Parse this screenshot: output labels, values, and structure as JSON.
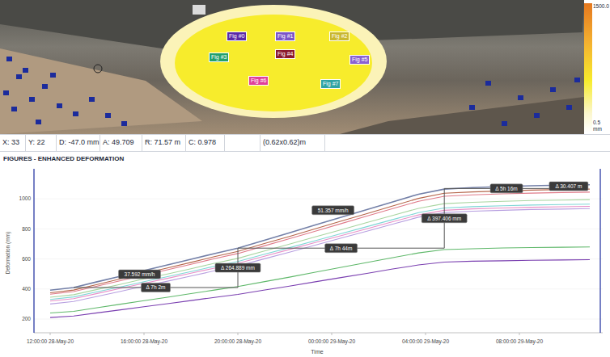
{
  "map": {
    "figures": [
      {
        "label": "Fig #0",
        "color": "#5b2aa6"
      },
      {
        "label": "Fig #1",
        "color": "#7b55c8"
      },
      {
        "label": "Fig #2",
        "color": "#c9b82e"
      },
      {
        "label": "Fig #3",
        "color": "#23a06c"
      },
      {
        "label": "Fig #4",
        "color": "#8b1a2e"
      },
      {
        "label": "Fig #5",
        "color": "#8a62d2"
      },
      {
        "label": "Fig #6",
        "color": "#e0409a"
      },
      {
        "label": "Fig #7",
        "color": "#2fa3a3"
      }
    ],
    "scale": {
      "max": "1500.0",
      "min": "0.5",
      "unit": "mm"
    }
  },
  "status_bar": [
    "X: 33",
    "Y: 22",
    "D: -47.0 mm",
    "A: 49.709",
    "R: 71.57 m",
    "C: 0.978",
    "(0.62x0.62)m"
  ],
  "chart": {
    "title": "FIGURES - ENHANCED DEFORMATION",
    "y_axis": {
      "label": "Deformation (mm)",
      "ticks": [
        "200",
        "400",
        "600",
        "800",
        "1000"
      ]
    },
    "x_axis": {
      "label": "Time",
      "ticks": [
        "12:00:00 28-May-20",
        "16:00:00 28-May-20",
        "20:00:00 28-May-20",
        "00:00:00 29-May-20",
        "04:00:00 29-May-20",
        "08:00:00 29-May-20"
      ]
    },
    "hours": [
      0,
      1,
      2,
      3,
      4,
      5,
      6,
      7,
      8,
      9.1,
      10.2,
      11.3,
      12.4,
      13.5,
      14.6,
      15.7,
      16.8,
      18,
      19.3,
      20.5,
      21.8,
      23
    ],
    "series": [
      {
        "color": "#7a3fb0",
        "values": [
          210,
          220,
          241,
          261,
          282,
          302,
          323,
          344,
          364,
          392,
          419,
          448,
          476,
          504,
          533,
          560,
          579,
          585,
          588,
          591,
          593,
          595
        ]
      },
      {
        "color": "#5fb86a",
        "values": [
          240,
          251,
          275,
          299,
          322,
          345,
          369,
          393,
          416,
          448,
          479,
          512,
          544,
          576,
          609,
          640,
          662,
          668,
          673,
          676,
          678,
          680
        ]
      },
      {
        "color": "#b8a0e0",
        "values": [
          300,
          317,
          351,
          384,
          419,
          452,
          486,
          521,
          553,
          600,
          645,
          692,
          739,
          785,
          832,
          878,
          909,
          918,
          924,
          929,
          932,
          935
        ]
      },
      {
        "color": "#e890c8",
        "values": [
          320,
          336,
          370,
          404,
          438,
          471,
          505,
          539,
          571,
          617,
          663,
          709,
          755,
          801,
          848,
          893,
          924,
          933,
          939,
          944,
          947,
          950
        ]
      },
      {
        "color": "#7fd6d6",
        "values": [
          330,
          347,
          381,
          414,
          449,
          482,
          516,
          551,
          583,
          630,
          675,
          722,
          769,
          815,
          862,
          908,
          939,
          948,
          954,
          959,
          962,
          965
        ]
      },
      {
        "color": "#a8d5a0",
        "values": [
          345,
          362,
          397,
          431,
          467,
          500,
          535,
          571,
          604,
          652,
          699,
          747,
          794,
          842,
          890,
          937,
          968,
          977,
          984,
          989,
          992,
          995
        ]
      },
      {
        "color": "#e07b8a",
        "values": [
          365,
          383,
          419,
          455,
          492,
          528,
          564,
          602,
          636,
          686,
          735,
          785,
          835,
          885,
          935,
          984,
          1017,
          1027,
          1033,
          1038,
          1042,
          1045
        ]
      },
      {
        "color": "#b5654a",
        "values": [
          375,
          393,
          430,
          467,
          504,
          540,
          577,
          615,
          650,
          701,
          750,
          801,
          852,
          902,
          953,
          1003,
          1037,
          1046,
          1053,
          1058,
          1062,
          1065
        ]
      },
      {
        "color": "#7480a8",
        "values": [
          392,
          410,
          448,
          485,
          523,
          560,
          598,
          636,
          672,
          723,
          774,
          826,
          877,
          928,
          980,
          1031,
          1065,
          1075,
          1082,
          1087,
          1091,
          1094
        ]
      }
    ],
    "measurements": [
      {
        "rate": "37.592 mm/h",
        "duration": "Δ 7h 2m",
        "delta": "Δ 264.889 mm",
        "start": [
          1,
          410
        ],
        "end": [
          8,
          672
        ]
      },
      {
        "rate": "51.357 mm/h",
        "duration": "Δ 7h 44m",
        "delta": "Δ 397.406 mm",
        "start": [
          8,
          672
        ],
        "end": [
          16.8,
          1069
        ]
      },
      {
        "duration": "Δ 5h 16m",
        "delta": "Δ 30.407 m",
        "start": [
          16.8,
          1069
        ],
        "end": [
          22.1,
          1099
        ]
      }
    ]
  }
}
